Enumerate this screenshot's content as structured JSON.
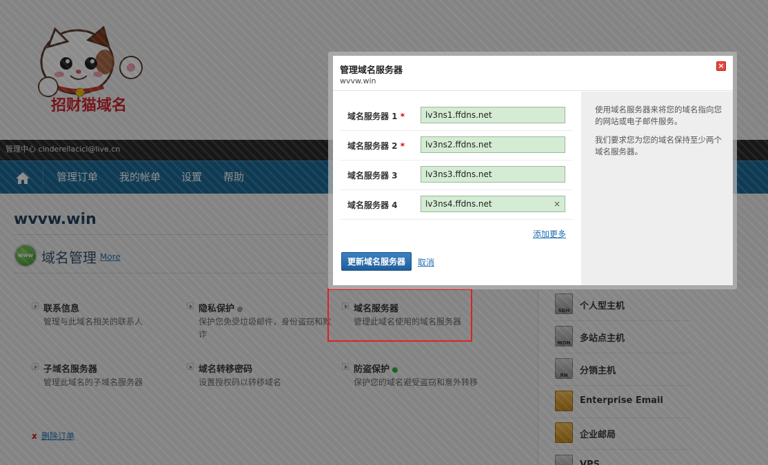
{
  "logo": {
    "text": "招财猫域名"
  },
  "topbar": {
    "text": "管理中心 cinderellacici@live.cn"
  },
  "nav": {
    "home_icon": "home-icon",
    "items": [
      "管理订单",
      "我的帐单",
      "设置",
      "帮助"
    ]
  },
  "domain": {
    "name": "wvvw.win"
  },
  "section": {
    "icon_text": "www",
    "title": "域名管理",
    "more": "More"
  },
  "features": [
    {
      "title": "联系信息",
      "desc": "管理与此域名相关的联系人"
    },
    {
      "title": "隐私保护",
      "desc": "保护您免受垃圾邮件，身份盗窃和欺诈",
      "status": "gray"
    },
    {
      "title": "域名服务器",
      "desc": "管理此域名使用的域名服务器"
    },
    {
      "title": "子域名服务器",
      "desc": "管理此域名的子域名服务器"
    },
    {
      "title": "域名转移密码",
      "desc": "设置授权码以转移域名"
    },
    {
      "title": "防盗保护",
      "desc": "保护您的域名避受盗窃和意外转移",
      "status": "green"
    }
  ],
  "delete": {
    "mark": "x",
    "label": "删除订单"
  },
  "sidebar": {
    "items": [
      {
        "icon": "SDH",
        "label": "个人型主机"
      },
      {
        "icon": "MDH",
        "label": "多站点主机"
      },
      {
        "icon": "RH",
        "label": "分销主机"
      },
      {
        "icon": "",
        "label": "Enterprise Email"
      },
      {
        "icon": "",
        "label": "企业邮局"
      },
      {
        "icon": "",
        "label": "VPS"
      }
    ]
  },
  "modal": {
    "title": "管理域名服务器",
    "subtitle": "wvvw.win",
    "close": "×",
    "nameservers": [
      {
        "label": "域名服务器 1",
        "required": "*",
        "value": "lv3ns1.ffdns.net"
      },
      {
        "label": "域名服务器 2",
        "required": "*",
        "value": "lv3ns2.ffdns.net"
      },
      {
        "label": "域名服务器 3",
        "required": "",
        "value": "lv3ns3.ffdns.net"
      },
      {
        "label": "域名服务器 4",
        "required": "",
        "value": "lv3ns4.ffdns.net"
      }
    ],
    "clear": "×",
    "add_more": "添加更多",
    "update_button": "更新域名服务器",
    "cancel": "取消",
    "side_text_1": "使用域名服务器来将您的域名指向您的网站或电子邮件服务。",
    "side_text_2": "我们要求您为您的域名保持至少两个域名服务器。"
  },
  "colors": {
    "nav": "#1c6a97",
    "accent": "#1f6fb0",
    "input_bg": "#d5ecd4",
    "highlight": "#e02020"
  }
}
